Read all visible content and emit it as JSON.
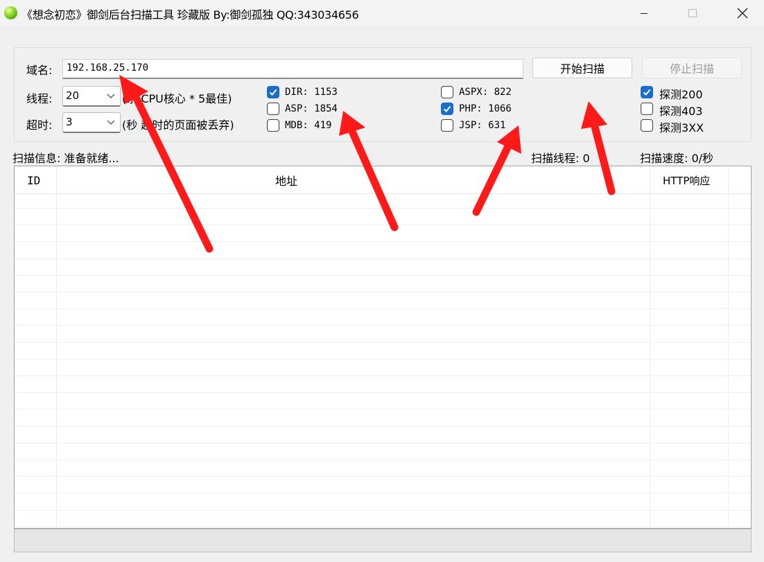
{
  "window": {
    "title": "《想念初恋》御剑后台扫描工具 珍藏版 By:御剑孤独 QQ:343034656",
    "icon": "app-green-orb-icon",
    "controls": [
      "minimize-icon",
      "maximize-icon",
      "close-icon"
    ]
  },
  "form": {
    "domain_label": "域名:",
    "domain_value": "192.168.25.170",
    "threads_label": "线程:",
    "threads_value": "20",
    "threads_hint": "(系 CPU核心 * 5最佳)",
    "timeout_label": "超时:",
    "timeout_value": "3",
    "timeout_hint": "(秒 超时的页面被丢弃)",
    "start_button": "开始扫描",
    "stop_button": "停止扫描"
  },
  "dictionaries": [
    {
      "label": "DIR: 1153",
      "checked": true
    },
    {
      "label": "ASP: 1854",
      "checked": false
    },
    {
      "label": "MDB: 419",
      "checked": false
    },
    {
      "label": "ASPX: 822",
      "checked": false
    },
    {
      "label": "PHP: 1066",
      "checked": true
    },
    {
      "label": "JSP: 631",
      "checked": false
    }
  ],
  "detect": [
    {
      "label": "探测200",
      "checked": true
    },
    {
      "label": "探测403",
      "checked": false
    },
    {
      "label": "探测3XX",
      "checked": false
    }
  ],
  "status": {
    "info": "扫描信息: 准备就绪...",
    "threads": "扫描线程: 0",
    "speed": "扫描速度: 0/秒"
  },
  "table": {
    "columns": [
      "ID",
      "地址",
      "HTTP响应"
    ],
    "rows": []
  },
  "colors": {
    "checkbox_checked": "#1a6fc4",
    "annotation_arrow": "#ff1a1a"
  }
}
